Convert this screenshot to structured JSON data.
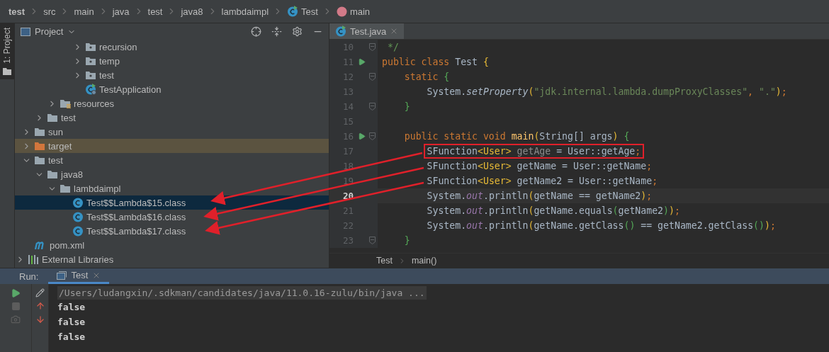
{
  "breadcrumbs": [
    {
      "label": "test",
      "kind": "module",
      "bold": true
    },
    {
      "label": "src",
      "kind": "path",
      "bold": false
    },
    {
      "label": "main",
      "kind": "path",
      "bold": false
    },
    {
      "label": "java",
      "kind": "path",
      "bold": false
    },
    {
      "label": "test",
      "kind": "path",
      "bold": false
    },
    {
      "label": "java8",
      "kind": "path",
      "bold": false
    },
    {
      "label": "lambdaimpl",
      "kind": "path",
      "bold": false
    },
    {
      "label": "Test",
      "kind": "class",
      "bold": false
    },
    {
      "label": "main",
      "kind": "method",
      "bold": false
    }
  ],
  "tool_strip": {
    "label": "1: Project",
    "selected": true
  },
  "project_panel": {
    "title": "Project",
    "tree": [
      {
        "children": [
          {
            "children": [
              {
                "children": [
                  {
                    "children": [
                      {
                        "children": [
                          {
                            "label": "recursion",
                            "kind": "package",
                            "expanded": false,
                            "selected": false
                          },
                          {
                            "label": "temp",
                            "kind": "package",
                            "expanded": false,
                            "selected": false
                          },
                          {
                            "label": "test",
                            "kind": "package",
                            "expanded": false,
                            "selected": false
                          },
                          {
                            "label": "TestApplication",
                            "kind": "spring-class",
                            "selected": false
                          }
                        ]
                      }
                    ]
                  },
                  {
                    "label": "resources",
                    "kind": "resources-folder",
                    "expanded": false,
                    "selected": false
                  }
                ]
              },
              {
                "label": "test",
                "kind": "folder",
                "expanded": false,
                "selected": false
              }
            ]
          },
          {
            "label": "sun",
            "kind": "folder",
            "expanded": false,
            "selected": false
          },
          {
            "label": "target",
            "kind": "excluded-folder",
            "expanded": false,
            "selected": false
          },
          {
            "label": "test",
            "kind": "folder",
            "expanded": true,
            "selected": false,
            "children": [
              {
                "label": "java8",
                "kind": "folder",
                "expanded": true,
                "selected": false,
                "children": [
                  {
                    "label": "lambdaimpl",
                    "kind": "folder",
                    "expanded": true,
                    "selected": false,
                    "children": [
                      {
                        "label": "Test$$Lambda$15.class",
                        "kind": "class",
                        "selected": true
                      },
                      {
                        "label": "Test$$Lambda$16.class",
                        "kind": "class",
                        "selected": false
                      },
                      {
                        "label": "Test$$Lambda$17.class",
                        "kind": "class",
                        "selected": false
                      }
                    ]
                  }
                ]
              }
            ]
          },
          {
            "label": "pom.xml",
            "kind": "maven",
            "selected": false
          }
        ]
      },
      {
        "label": "External Libraries",
        "kind": "libraries",
        "expanded": false,
        "selected": false
      }
    ]
  },
  "editor": {
    "tabs": [
      {
        "label": "Test.java",
        "selected": true
      }
    ],
    "lines": [
      {
        "number": "10",
        "fold": true,
        "run": false,
        "current": false,
        "tokens": [
          {
            "text": " */",
            "kind": "comment"
          }
        ]
      },
      {
        "number": "11",
        "fold": false,
        "run": true,
        "current": false,
        "tokens": [
          {
            "text": "public class ",
            "kind": "keyword"
          },
          {
            "text": "Test ",
            "kind": "plain"
          },
          {
            "text": "{",
            "kind": "brace1"
          }
        ]
      },
      {
        "number": "12",
        "fold": true,
        "run": false,
        "current": false,
        "tokens": [
          {
            "text": "    static ",
            "kind": "keyword"
          },
          {
            "text": "{",
            "kind": "brace2"
          }
        ]
      },
      {
        "number": "13",
        "fold": false,
        "run": false,
        "current": false,
        "tokens": [
          {
            "text": "        System.",
            "kind": "plain"
          },
          {
            "text": "setProperty",
            "kind": "method"
          },
          {
            "text": "(",
            "kind": "brace1"
          },
          {
            "text": "\"jdk.internal.lambda.dumpProxyClasses\"",
            "kind": "string"
          },
          {
            "text": ", ",
            "kind": "keyword"
          },
          {
            "text": "\".\"",
            "kind": "string"
          },
          {
            "text": ")",
            "kind": "brace1"
          },
          {
            "text": ";",
            "kind": "keyword"
          }
        ]
      },
      {
        "number": "14",
        "fold": true,
        "run": false,
        "current": false,
        "tokens": [
          {
            "text": "    }",
            "kind": "brace2"
          }
        ]
      },
      {
        "number": "15",
        "fold": false,
        "run": false,
        "current": false
      },
      {
        "number": "16",
        "fold": true,
        "run": true,
        "current": false,
        "tokens": [
          {
            "text": "    public static void ",
            "kind": "keyword"
          },
          {
            "text": "main",
            "kind": "decl"
          },
          {
            "text": "(",
            "kind": "brace1"
          },
          {
            "text": "String[] args",
            "kind": "plain"
          },
          {
            "text": ") ",
            "kind": "brace1"
          },
          {
            "text": "{",
            "kind": "brace2"
          }
        ]
      },
      {
        "number": "17",
        "fold": false,
        "run": false,
        "current": false,
        "framed": true,
        "tokens": [
          {
            "text": "        SFunction",
            "kind": "plain"
          },
          {
            "text": "<User>",
            "kind": "brace1"
          },
          {
            "text": " getAge",
            "kind": "unused"
          },
          {
            "text": " = User::getAge",
            "kind": "plain"
          },
          {
            "text": ";",
            "kind": "keyword"
          }
        ]
      },
      {
        "number": "18",
        "fold": false,
        "run": false,
        "current": false,
        "tokens": [
          {
            "text": "        SFunction",
            "kind": "plain"
          },
          {
            "text": "<User>",
            "kind": "brace1"
          },
          {
            "text": " getName = User::getName",
            "kind": "plain"
          },
          {
            "text": ";",
            "kind": "keyword"
          }
        ]
      },
      {
        "number": "19",
        "fold": false,
        "run": false,
        "current": false,
        "tokens": [
          {
            "text": "        SFunction",
            "kind": "plain"
          },
          {
            "text": "<User>",
            "kind": "brace1"
          },
          {
            "text": " getName2 = User::getName",
            "kind": "plain"
          },
          {
            "text": ";",
            "kind": "keyword"
          }
        ]
      },
      {
        "number": "20",
        "fold": false,
        "run": false,
        "current": true,
        "tokens": [
          {
            "text": "        System.",
            "kind": "plain"
          },
          {
            "text": "out",
            "kind": "field"
          },
          {
            "text": ".println",
            "kind": "plain"
          },
          {
            "text": "(",
            "kind": "brace1"
          },
          {
            "text": "getName == getName2",
            "kind": "plain"
          },
          {
            "text": ")",
            "kind": "brace1"
          },
          {
            "text": ";",
            "kind": "keyword"
          }
        ]
      },
      {
        "number": "21",
        "fold": false,
        "run": false,
        "current": false,
        "tokens": [
          {
            "text": "        System.",
            "kind": "plain"
          },
          {
            "text": "out",
            "kind": "field"
          },
          {
            "text": ".println",
            "kind": "plain"
          },
          {
            "text": "(",
            "kind": "brace1"
          },
          {
            "text": "getName.equals",
            "kind": "plain"
          },
          {
            "text": "(",
            "kind": "brace2"
          },
          {
            "text": "getName2",
            "kind": "plain"
          },
          {
            "text": ")",
            "kind": "brace2"
          },
          {
            "text": ")",
            "kind": "brace1"
          },
          {
            "text": ";",
            "kind": "keyword"
          }
        ]
      },
      {
        "number": "22",
        "fold": false,
        "run": false,
        "current": false,
        "tokens": [
          {
            "text": "        System.",
            "kind": "plain"
          },
          {
            "text": "out",
            "kind": "field"
          },
          {
            "text": ".println",
            "kind": "plain"
          },
          {
            "text": "(",
            "kind": "brace1"
          },
          {
            "text": "getName.getClass",
            "kind": "plain"
          },
          {
            "text": "()",
            "kind": "brace2"
          },
          {
            "text": " == getName2.getClass",
            "kind": "plain"
          },
          {
            "text": "()",
            "kind": "brace2"
          },
          {
            "text": ")",
            "kind": "brace1"
          },
          {
            "text": ";",
            "kind": "keyword"
          }
        ]
      },
      {
        "number": "23",
        "fold": true,
        "run": false,
        "current": false,
        "tokens": [
          {
            "text": "    }",
            "kind": "brace2"
          }
        ]
      }
    ],
    "breadcrumbs": [
      "Test",
      "main()"
    ]
  },
  "run_panel": {
    "label": "Run:",
    "tabs": [
      {
        "label": "Test",
        "selected": true
      }
    ],
    "command": "/Users/ludangxin/.sdkman/candidates/java/11.0.16-zulu/bin/java ...",
    "output": [
      "false",
      "false",
      "false"
    ]
  }
}
